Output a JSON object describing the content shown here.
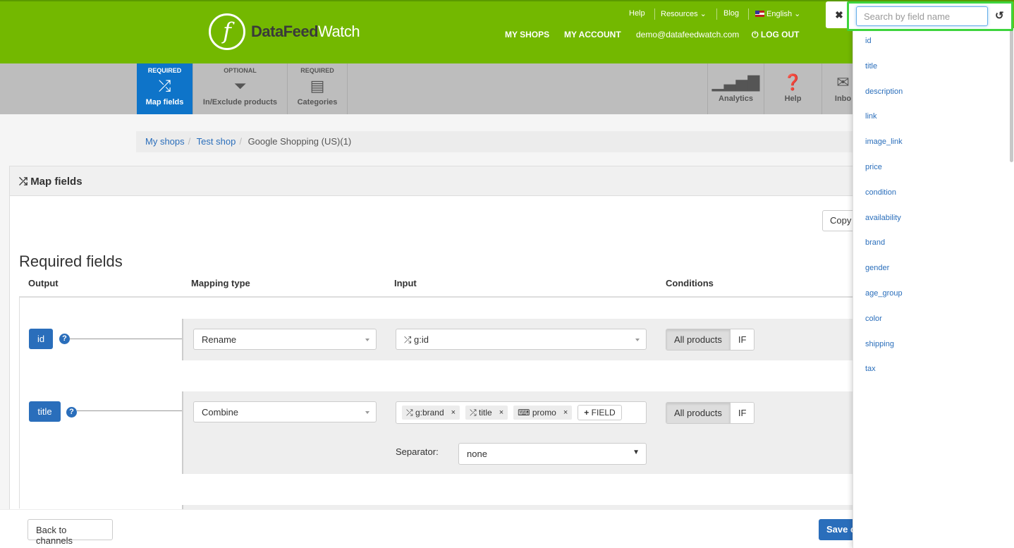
{
  "header": {
    "logo_mark": "f",
    "logo_bold": "DataFeed",
    "logo_light": "Watch",
    "top_links": {
      "help": "Help",
      "resources": "Resources",
      "blog": "Blog",
      "language": "English"
    },
    "nav": {
      "my_shops": "MY SHOPS",
      "my_account": "MY ACCOUNT",
      "email": "demo@datafeedwatch.com",
      "logout": "LOG OUT"
    }
  },
  "steps": [
    {
      "label": "REQUIRED",
      "name": "Map fields",
      "icon": "shuffle-icon",
      "active": true
    },
    {
      "label": "OPTIONAL",
      "name": "In/Exclude products",
      "icon": "filter-icon",
      "active": false
    },
    {
      "label": "REQUIRED",
      "name": "Categories",
      "icon": "list-icon",
      "active": false
    }
  ],
  "tools": [
    {
      "name": "Analytics",
      "icon": "bar-chart-icon"
    },
    {
      "name": "Help",
      "icon": "question-circle-icon"
    },
    {
      "name": "Inbo",
      "icon": "envelope-icon"
    }
  ],
  "breadcrumb": [
    "My shops",
    "Test shop",
    "Google Shopping (US)(1)"
  ],
  "panel": {
    "title": "Map fields",
    "copy_label": "Copy"
  },
  "section": {
    "title": "Required fields",
    "columns": {
      "output": "Output",
      "mapping": "Mapping type",
      "input": "Input",
      "conditions": "Conditions"
    }
  },
  "rows": [
    {
      "output": "id",
      "mapping": "Rename",
      "input": "g:id",
      "cond_all": "All products",
      "cond_if": "IF"
    },
    {
      "output": "title",
      "mapping": "Combine",
      "chips": [
        {
          "icon": "shuffle-icon",
          "label": "g:brand"
        },
        {
          "icon": "shuffle-icon",
          "label": "title"
        },
        {
          "icon": "keyboard-icon",
          "label": "promo"
        }
      ],
      "field_btn": "FIELD",
      "separator_label": "Separator:",
      "separator_value": "none",
      "cond_all": "All products",
      "cond_if": "IF"
    }
  ],
  "footer": {
    "back": "Back to channels",
    "save": "Save c"
  },
  "sidebar": {
    "search_placeholder": "Search by field name",
    "search_value": "",
    "fields": [
      "id",
      "title",
      "description",
      "link",
      "image_link",
      "price",
      "condition",
      "availability",
      "brand",
      "gender",
      "age_group",
      "color",
      "shipping",
      "tax"
    ]
  },
  "colors": {
    "brand_green": "#73b800",
    "primary_blue": "#2a6ebb",
    "highlight_green": "#3ed43e"
  }
}
